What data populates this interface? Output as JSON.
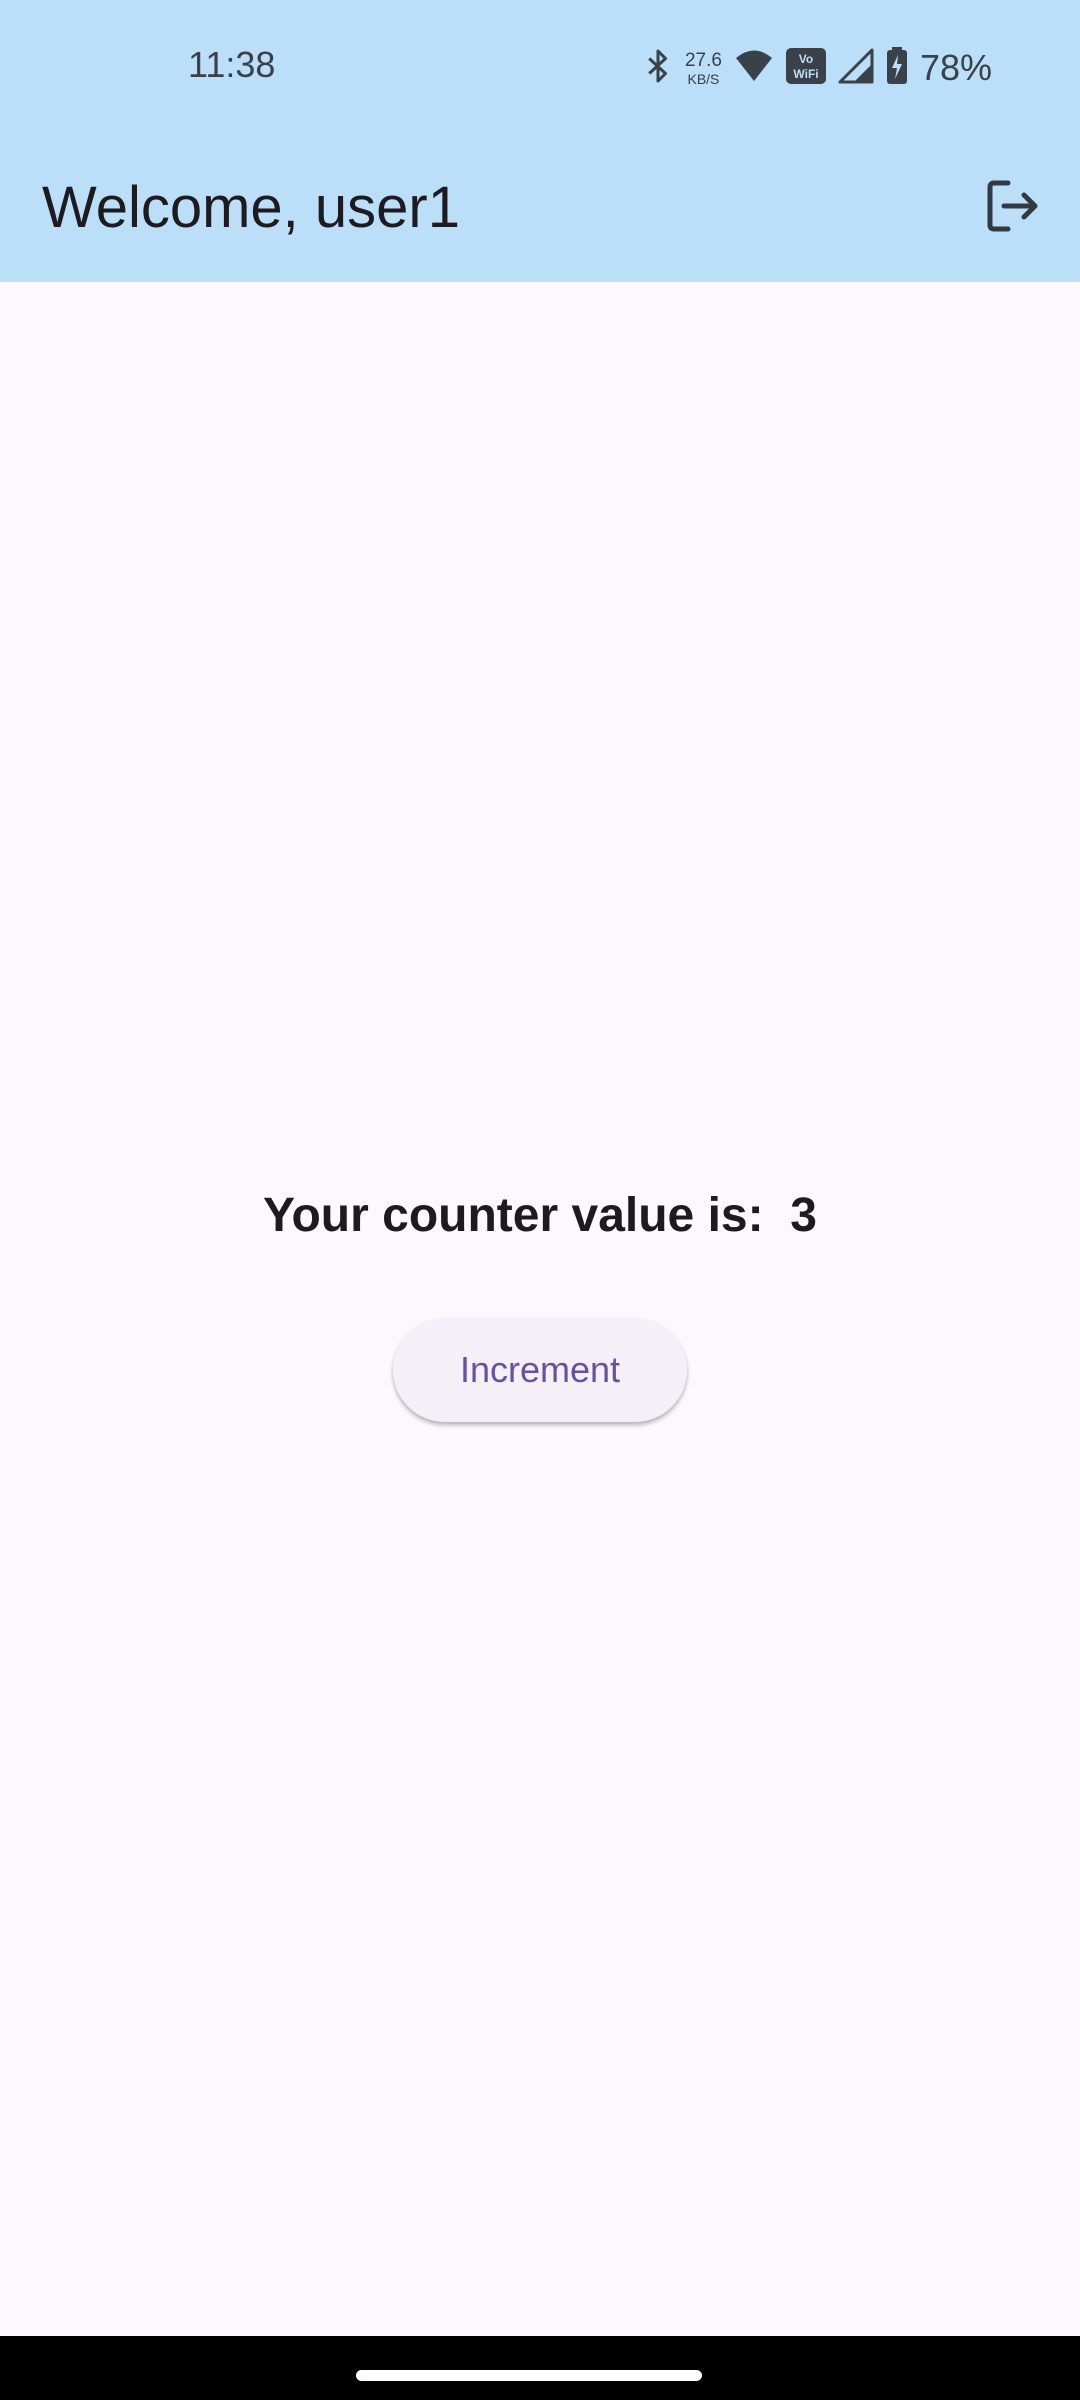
{
  "status_bar": {
    "time": "11:38",
    "net_speed_value": "27.6",
    "net_speed_unit": "KB/S",
    "vowifi_label": "Vo WiFi",
    "battery_percent": "78%",
    "icons": [
      "bluetooth-icon",
      "wifi-icon",
      "vowifi-icon",
      "signal-icon",
      "battery-charging-icon"
    ]
  },
  "app_bar": {
    "title": "Welcome, user1",
    "action_icon": "logout-icon"
  },
  "main": {
    "counter_label": "Your counter value is:",
    "counter_value": "3",
    "increment_label": "Increment"
  },
  "colors": {
    "app_bar_bg": "#bbdef9",
    "page_bg": "#fdf7fe",
    "button_text": "#6750a4",
    "button_bg": "#f5eff7"
  }
}
